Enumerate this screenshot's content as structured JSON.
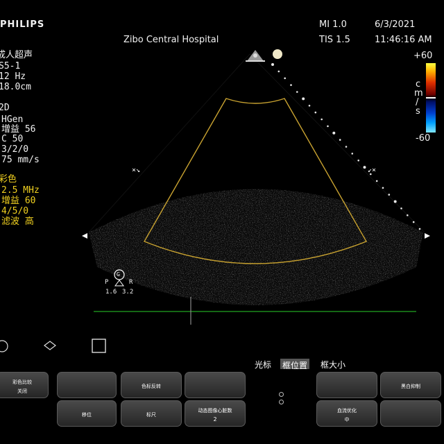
{
  "header": {
    "logo": "PHILIPS",
    "hospital": "Zibo Central Hospital",
    "mi": "MI 1.0",
    "tis": "TIS 1.5",
    "date": "6/3/2021",
    "time": "11:46:16 AM"
  },
  "preset": {
    "lines": [
      "成人超声",
      "S5-1",
      "12 Hz",
      "18.0cm"
    ]
  },
  "mode_2d": {
    "title": "2D",
    "lines": [
      "HGen",
      "增益 56",
      "C 50",
      "3/2/0",
      "75 mm/s"
    ]
  },
  "color_mode": {
    "title": "彩色",
    "lines": [
      "2.5 MHz",
      "增益 60",
      "4/5/0",
      "滤波 高"
    ]
  },
  "color_scale": {
    "top": "+60",
    "bottom": "-60",
    "unit": [
      "c",
      "m",
      "/",
      "s"
    ]
  },
  "focus_indicator": {
    "badge": "G",
    "left": "P",
    "right": "R",
    "left_val": "1.6",
    "right_val": "3.2"
  },
  "panel": {
    "tabs": [
      "光标",
      "框位置",
      "框大小"
    ],
    "buttons": [
      {
        "label": "彩色比较",
        "sub": "关闭"
      },
      {
        "label": ""
      },
      {
        "label": "色标反转"
      },
      {
        "label": ""
      },
      {
        "label": ""
      },
      {
        "label": "黑白抑制"
      },
      {
        "label": "移位"
      },
      {
        "label": "标尺"
      },
      {
        "label": "动态图像心脏数",
        "sub": "2"
      },
      {
        "label": "血流优化",
        "sub": "中"
      },
      {
        "label": ""
      }
    ]
  },
  "icons": [
    "transducer-icon",
    "sun-icon",
    "print-icon",
    "image-icon",
    "frame-icon"
  ]
}
